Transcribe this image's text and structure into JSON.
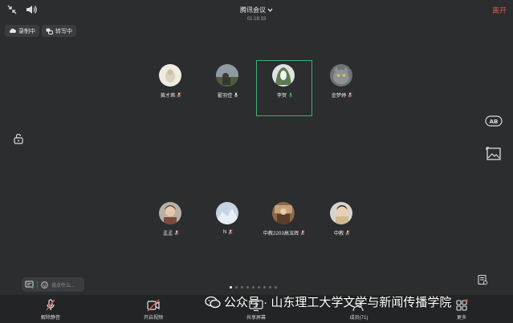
{
  "header": {
    "title": "腾讯会议",
    "timer": "01:18:33",
    "leave_label": "离开"
  },
  "pills": {
    "record": "录制中",
    "transcribe": "转写中"
  },
  "participants": [
    {
      "name": "黄才茜",
      "muted": true
    },
    {
      "name": "翟羽佳",
      "muted": false
    },
    {
      "name": "李贺",
      "muted": false,
      "active": true
    },
    {
      "name": "金梦婷",
      "muted": true
    },
    {
      "name": "孟孟",
      "muted": true
    },
    {
      "name": "N",
      "muted": true
    },
    {
      "name": "中教2203高玉辉",
      "muted": true
    },
    {
      "name": "中教",
      "muted": true
    }
  ],
  "comment": {
    "placeholder": "说点什么..."
  },
  "toolbar": {
    "unmute": "解除静音",
    "video": "开启视频",
    "share": "共享屏幕",
    "members": "成员(71)",
    "more": "更多"
  },
  "watermark": "公众号 · 山东理工大学文学与新闻传播学院",
  "colors": {
    "background": "#2b2d2f",
    "active_border": "#3bb273",
    "leave": "#e0584f",
    "muted_icon": "#e05a4f"
  }
}
